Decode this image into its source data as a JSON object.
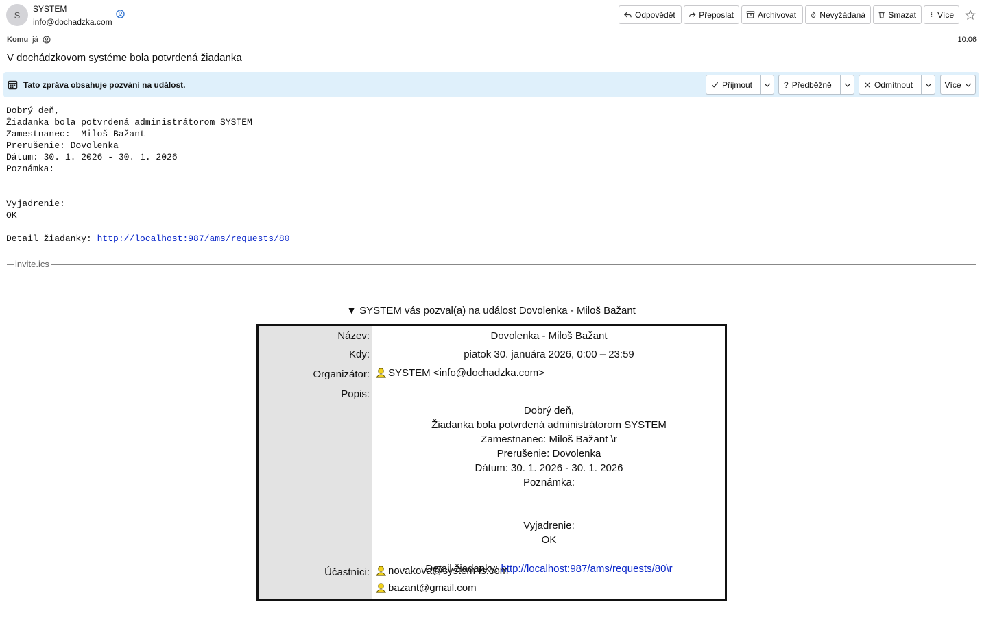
{
  "sender": {
    "initial": "S",
    "name": "SYSTEM",
    "email": "info@dochadzka.com"
  },
  "toolbar": {
    "reply": "Odpovědět",
    "forward": "Přeposlat",
    "archive": "Archivovat",
    "junk": "Nevyžádaná",
    "delete": "Smazat",
    "more": "Více"
  },
  "recipient": {
    "label": "Komu",
    "value": "já"
  },
  "time": "10:06",
  "subject": "V dochádzkovom systéme bola potvrdená žiadanka",
  "invite_banner": {
    "text": "Tato zpráva obsahuje pozvání na událost.",
    "accept": "Přijmout",
    "tentative": "Předběžně",
    "decline": "Odmítnout",
    "more": "Více"
  },
  "body": {
    "lines": [
      "Dobrý deň,",
      "Žiadanka bola potvrdená administrátorom SYSTEM",
      "Zamestnanec:  Miloš Bažant",
      "Prerušenie: Dovolenka",
      "Dátum: 30. 1. 2026 - 30. 1. 2026",
      "Poznámka:",
      "",
      "",
      "Vyjadrenie:",
      "OK",
      ""
    ],
    "detail_label": "Detail žiadanky: ",
    "detail_link": "http://localhost:987/ams/requests/80"
  },
  "attachment_name": "invite.ics",
  "event": {
    "title": "▼ SYSTEM vás pozval(a) na událost Dovolenka - Miloš Bažant",
    "labels": {
      "name": "Název:",
      "when": "Kdy:",
      "organizer": "Organizátor:",
      "description": "Popis:",
      "attendees": "Účastníci:"
    },
    "name": "Dovolenka - Miloš Bažant",
    "when": "piatok 30. januára 2026, 0:00 – 23:59",
    "organizer": "SYSTEM <info@dochadzka.com>",
    "description_lines": "Dobrý deň,\nŽiadanka bola potvrdená administrátorom SYSTEM\nZamestnanec: Miloš Bažant \\r\nPrerušenie: Dovolenka\nDátum: 30. 1. 2026 - 30. 1. 2026\nPoznámka:\n\n\nVyjadrenie:\nOK\n",
    "description_detail_label": "Detail žiadanky: ",
    "description_detail_link": "http://localhost:987/ams/requests/80\\r",
    "attendees": [
      "novakova@system-is.com",
      "bazant@gmail.com"
    ]
  }
}
